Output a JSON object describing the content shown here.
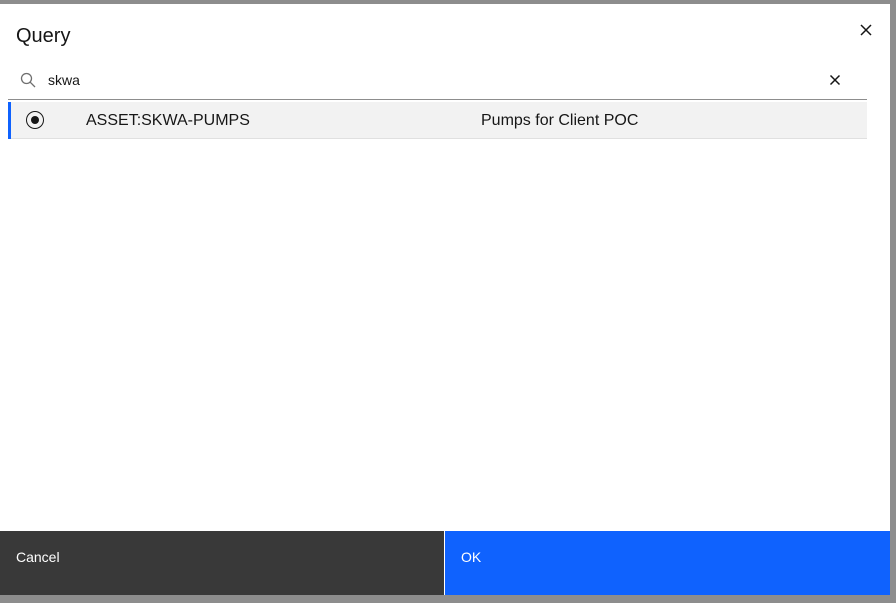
{
  "dialog": {
    "title": "Query",
    "close_icon": "close-icon"
  },
  "search": {
    "icon": "search-icon",
    "value": "skwa",
    "clear_icon": "clear-icon"
  },
  "results": [
    {
      "selected": true,
      "name": "ASSET:SKWA-PUMPS",
      "description": "Pumps for Client POC"
    }
  ],
  "footer": {
    "cancel_label": "Cancel",
    "ok_label": "OK"
  },
  "colors": {
    "primary": "#0f62fe",
    "secondary_button": "#393939",
    "selected_row": "#f2f2f2",
    "overlay": "#8d8d8d"
  }
}
